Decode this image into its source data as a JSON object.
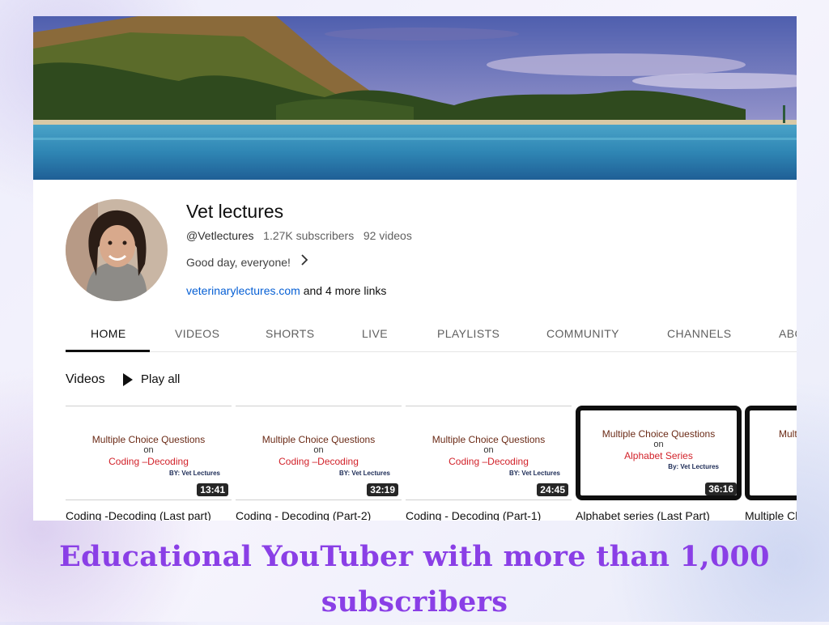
{
  "channel": {
    "name": "Vet lectures",
    "handle": "@Vetlectures",
    "subscribers": "1.27K subscribers",
    "videos_count": "92 videos",
    "description": "Good day, everyone!",
    "link": "veterinarylectures.com",
    "more_links": "and 4 more links"
  },
  "tabs": [
    "HOME",
    "VIDEOS",
    "SHORTS",
    "LIVE",
    "PLAYLISTS",
    "COMMUNITY",
    "CHANNELS",
    "ABOUT"
  ],
  "active_tab": "HOME",
  "section": {
    "title": "Videos",
    "play_all": "Play all"
  },
  "videos": [
    {
      "thumb_line1": "Multiple Choice Questions",
      "thumb_line2": "on",
      "thumb_line3": "Coding –Decoding",
      "thumb_author": "BY: Vet Lectures",
      "duration": "13:41",
      "title": "Coding -Decoding (Last part)"
    },
    {
      "thumb_line1": "Multiple Choice Questions",
      "thumb_line2": "on",
      "thumb_line3": "Coding –Decoding",
      "thumb_author": "BY: Vet Lectures",
      "duration": "32:19",
      "title": "Coding - Decoding (Part-2)"
    },
    {
      "thumb_line1": "Multiple Choice Questions",
      "thumb_line2": "on",
      "thumb_line3": "Coding –Decoding",
      "thumb_author": "BY: Vet Lectures",
      "duration": "24:45",
      "title": "Coding - Decoding (Part-1)"
    },
    {
      "thumb_line1": "Multiple Choice Questions",
      "thumb_line2": "on",
      "thumb_line3": "Alphabet Series",
      "thumb_author": "By: Vet Lectures",
      "duration": "36:16",
      "title": "Alphabet series (Last Part)"
    },
    {
      "thumb_line1": "Mult",
      "thumb_line2": "",
      "thumb_line3": "",
      "thumb_author": "",
      "duration": "",
      "title": "Multiple Cl"
    }
  ],
  "headline": "Educational YouTuber with more than 1,000 subscribers",
  "colors": {
    "headline": "#8a3fe6",
    "link": "#065fd4",
    "thumb_red": "#d2222a"
  },
  "icons": [
    "chevron-right-icon",
    "play-icon"
  ]
}
